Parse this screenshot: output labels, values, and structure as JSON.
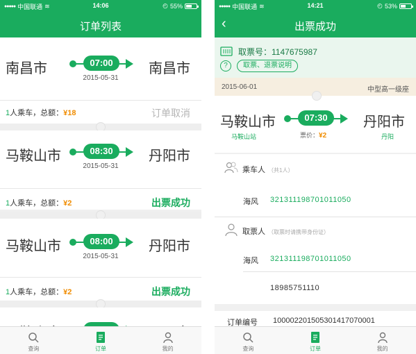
{
  "colors": {
    "brand": "#1aac5e",
    "amount": "#f08c00",
    "muted": "#b5b5b5"
  },
  "left": {
    "status_bar": {
      "carrier": "中国联通",
      "time": "14:06",
      "battery": "55%",
      "battery_level": 0.55
    },
    "title": "订单列表",
    "orders": [
      {
        "from": "南昌市",
        "to": "南昌市",
        "time": "07:00",
        "date": "2015-05-31",
        "count": "1",
        "count_suffix": "人乘车，总额：",
        "amount": "¥18",
        "status": "订单取消"
      },
      {
        "from": "马鞍山市",
        "to": "丹阳市",
        "time": "08:30",
        "date": "2015-05-31",
        "count": "1",
        "count_suffix": "人乘车，总额：",
        "amount": "¥2",
        "status": "出票成功"
      },
      {
        "from": "马鞍山市",
        "to": "丹阳市",
        "time": "08:00",
        "date": "2015-05-31",
        "count": "1",
        "count_suffix": "人乘车，总额：",
        "amount": "¥2",
        "status": "出票成功"
      },
      {
        "from": "马鞍山市",
        "to": "丹阳市"
      }
    ],
    "tabs": [
      {
        "label": "查询",
        "icon": "search-icon"
      },
      {
        "label": "订单",
        "icon": "document-icon"
      },
      {
        "label": "我的",
        "icon": "user-icon"
      }
    ]
  },
  "right": {
    "status_bar": {
      "carrier": "中国联通",
      "time": "14:21",
      "battery": "53%",
      "battery_level": 0.53
    },
    "back": "‹",
    "title": "出票成功",
    "ticket_no_label": "取票号：",
    "ticket_no": "1147675987",
    "help_icon": "?",
    "help_link": "取票、退票说明",
    "date": "2015-06-01",
    "seat": "中型高一级座",
    "trip": {
      "from": "马鞍山市",
      "from_station": "马鞍山站",
      "to": "丹阳市",
      "to_station": "丹阳",
      "time": "07:30",
      "price_label": "票价：",
      "price": "¥2"
    },
    "passenger": {
      "title": "乘车人",
      "hint": "（共1人）",
      "name": "海风",
      "id": "321311198701011050"
    },
    "collector": {
      "title": "取票人",
      "hint": "（取票时请携带身份证）",
      "name": "海风",
      "id": "321311198701011050",
      "phone": "18985751110"
    },
    "order_no_label": "订单编号",
    "order_no": "100002201505301417070001",
    "tabs": [
      {
        "label": "查询",
        "icon": "search-icon"
      },
      {
        "label": "订单",
        "icon": "document-icon"
      },
      {
        "label": "我的",
        "icon": "user-icon"
      }
    ]
  }
}
